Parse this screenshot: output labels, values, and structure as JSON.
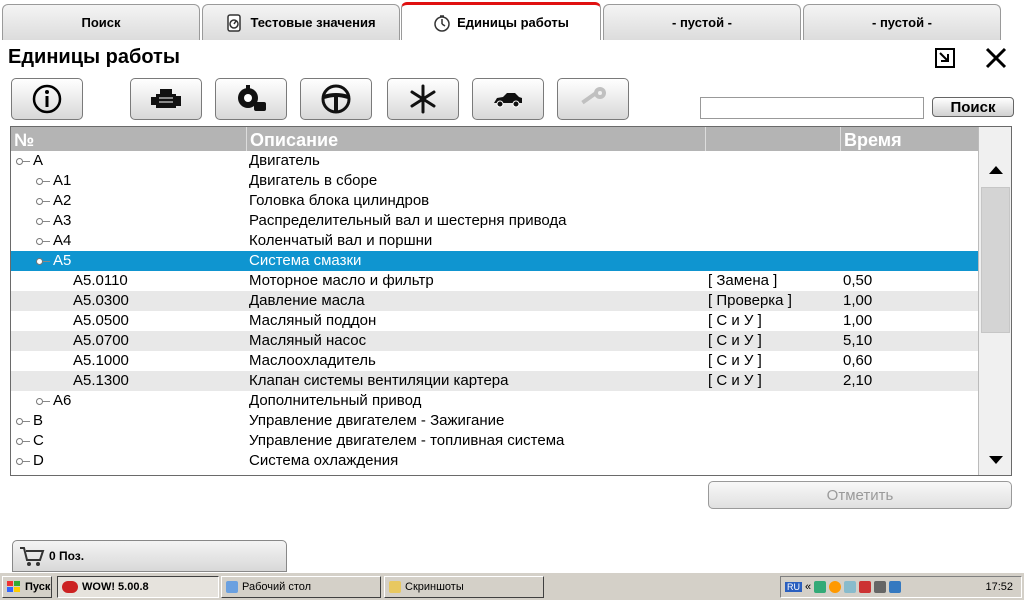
{
  "tabs": [
    {
      "label": "Поиск",
      "icon": "none"
    },
    {
      "label": "Тестовые значения",
      "icon": "gauge-icon"
    },
    {
      "label": "Единицы работы",
      "icon": "clock-icon",
      "active": true
    },
    {
      "label": "- пустой -"
    },
    {
      "label": "- пустой -"
    }
  ],
  "page": {
    "title": "Единицы работы"
  },
  "toolbar": {
    "buttons": [
      "info-icon",
      "engine-icon",
      "transmission-icon",
      "steering-wheel-icon",
      "snowflake-icon",
      "car-body-icon",
      "key-icon"
    ],
    "search_value": "",
    "search_label": "Поиск"
  },
  "table": {
    "headers": {
      "code": "№",
      "description": "Описание",
      "operation": "",
      "time": "Время"
    },
    "rows": [
      {
        "code": "A",
        "description": "Двигатель",
        "operation": "",
        "time": "",
        "level": 0
      },
      {
        "code": "A1",
        "description": "Двигатель в сборе",
        "operation": "",
        "time": "",
        "level": 1
      },
      {
        "code": "A2",
        "description": "Головка блока цилиндров",
        "operation": "",
        "time": "",
        "level": 1
      },
      {
        "code": "A3",
        "description": "Распределительный вал и шестерня привода",
        "operation": "",
        "time": "",
        "level": 1
      },
      {
        "code": "A4",
        "description": "Коленчатый вал и поршни",
        "operation": "",
        "time": "",
        "level": 1
      },
      {
        "code": "A5",
        "description": "Система смазки",
        "operation": "",
        "time": "",
        "level": 1,
        "selected": true
      },
      {
        "code": "A5.0110",
        "description": "Моторное масло и фильтр",
        "operation": "[ Замена ]",
        "time": "0,50",
        "level": 2
      },
      {
        "code": "A5.0300",
        "description": "Давление масла",
        "operation": "[ Проверка ]",
        "time": "1,00",
        "level": 2
      },
      {
        "code": "A5.0500",
        "description": "Масляный поддон",
        "operation": "[ С и У ]",
        "time": "1,00",
        "level": 2
      },
      {
        "code": "A5.0700",
        "description": "Масляный насос",
        "operation": "[ С и У ]",
        "time": "5,10",
        "level": 2
      },
      {
        "code": "A5.1000",
        "description": "Маслоохладитель",
        "operation": "[ С и У ]",
        "time": "0,60",
        "level": 2
      },
      {
        "code": "A5.1300",
        "description": "Клапан системы вентиляции картера",
        "operation": "[ С и У ]",
        "time": "2,10",
        "level": 2
      },
      {
        "code": "A6",
        "description": "Дополнительный привод",
        "operation": "",
        "time": "",
        "level": 1
      },
      {
        "code": "B",
        "description": "Управление двигателем - Зажигание",
        "operation": "",
        "time": "",
        "level": 0
      },
      {
        "code": "C",
        "description": "Управление двигателем - топливная система",
        "operation": "",
        "time": "",
        "level": 0
      },
      {
        "code": "D",
        "description": "Система охлаждения",
        "operation": "",
        "time": "",
        "level": 0
      }
    ]
  },
  "actions": {
    "mark_label": "Отметить",
    "cart_label": "0 Поз."
  },
  "taskbar": {
    "start": "Пуск",
    "items": [
      "WOW! 5.00.8",
      "Рабочий стол",
      "Скриншоты"
    ],
    "lang": "RU",
    "clock": "17:52"
  },
  "colors": {
    "selection": "#0f95d0",
    "header": "#b4b4b4",
    "active_tab_accent": "#e01010"
  }
}
